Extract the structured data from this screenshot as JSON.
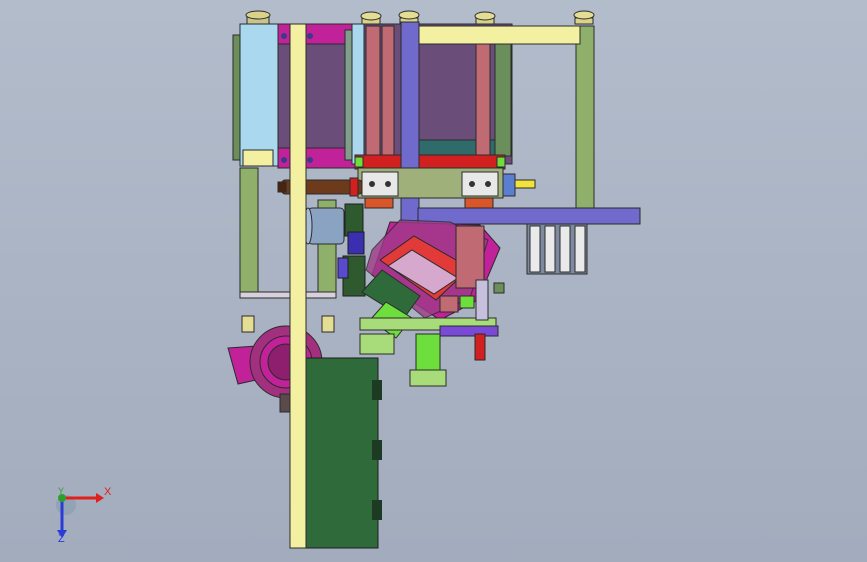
{
  "viewport": {
    "background_top": "#b3bccb",
    "background_bottom": "#a2acbd"
  },
  "triad": {
    "x_label": "X",
    "y_label": "Y",
    "z_label": "Z",
    "x_color": "#e0201c",
    "y_color": "#2ea02a",
    "z_color": "#2a3bd6"
  },
  "colors": {
    "yellow_frame": "#f4f0a2",
    "green_frame": "#8fb06b",
    "light_blue": "#a9d8ef",
    "purple_panel": "#6a4d79",
    "magenta": "#c1229a",
    "blue_bar": "#6f6acb",
    "salmon": "#c06a73",
    "dark_green": "#2f6b3a",
    "lime": "#6dde3c",
    "red": "#d21f1f",
    "brown": "#6d3a1c",
    "gray_cyl": "#8aa3c3"
  }
}
